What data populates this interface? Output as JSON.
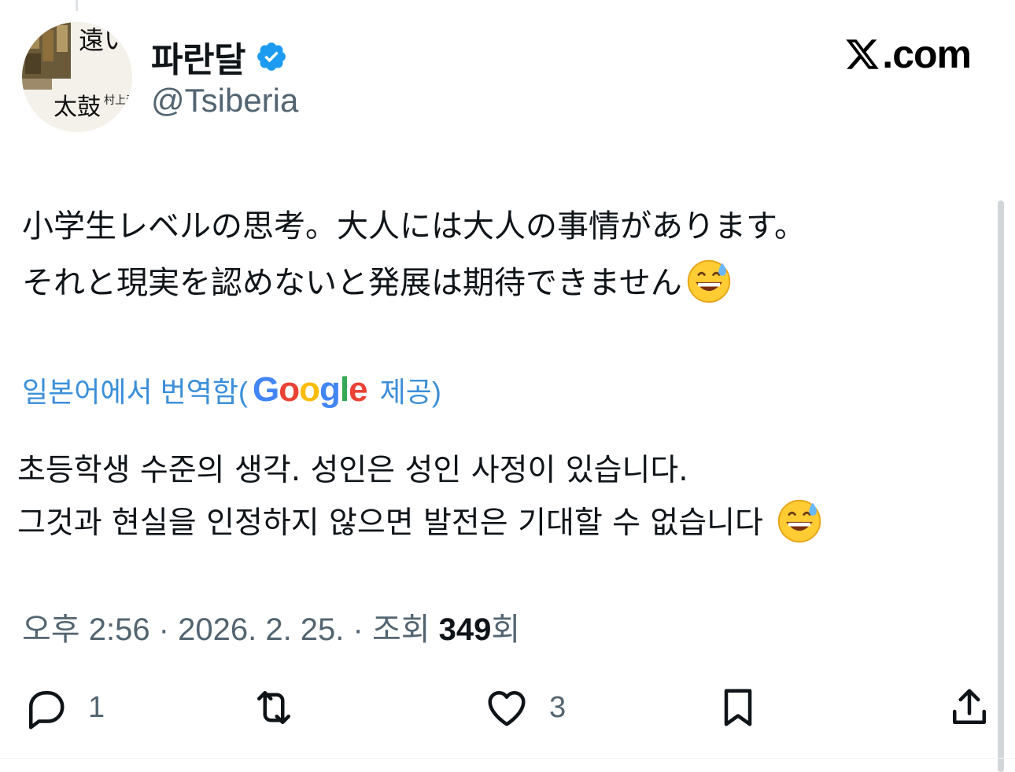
{
  "author": {
    "name": "파란달",
    "handle": "@Tsiberia",
    "verified": true,
    "avatar_icon": "book-cover-avatar",
    "avatar_text": [
      "遠い",
      "太鼓",
      "村上春樹"
    ]
  },
  "brand": {
    "text": ".com",
    "icon": "x-logo-icon"
  },
  "tweet": {
    "line1": "小学生レベルの思考。大人には大人の事情があります。",
    "line2": "それと現実を認めないと発展は期待できません",
    "emoji": "grinning-face-with-sweat-emoji"
  },
  "translation_bar": {
    "prefix": "일본어에서 번역함(",
    "provider": "Google",
    "suffix": "제공)"
  },
  "translation": {
    "line1": "초등학생 수준의 생각. 성인은 성인 사정이 있습니다.",
    "line2": "그것과 현실을 인정하지 않으면 발전은 기대할 수 없습니다"
  },
  "meta": {
    "time_date": "오후 2:56 · 2026. 2. 25. · 조회 ",
    "views": "349",
    "views_suffix": "회"
  },
  "actions": {
    "replies": "1",
    "likes": "3"
  },
  "colors": {
    "link_blue": "#3b8fd9",
    "verified_blue": "#1d9bf0",
    "secondary_text": "#536471"
  }
}
